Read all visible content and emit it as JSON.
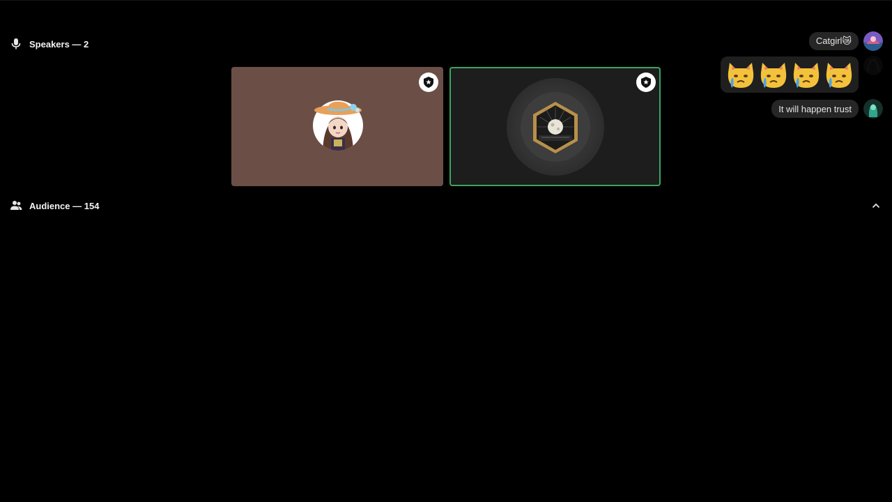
{
  "speakers": {
    "label": "Speakers — 2",
    "icon": "microphone-icon"
  },
  "audience": {
    "label": "Audience — 154",
    "icon": "people-icon",
    "collapse_icon": "chevron-up-icon"
  },
  "tiles": [
    {
      "name": "speaker-tile-1",
      "background": "#6b4f47",
      "speaking": false,
      "badge": "moderator-badge"
    },
    {
      "name": "speaker-tile-2",
      "background": "#1d1d1d",
      "speaking": true,
      "speaking_color": "#3ba55d",
      "badge": "moderator-badge"
    }
  ],
  "chat": {
    "messages": [
      {
        "author_avatar": "avatar-catgirl",
        "text": "Catgirl😿"
      },
      {
        "author_avatar": "avatar-ghost",
        "emoji": [
          "😿",
          "😿",
          "😿",
          "😿"
        ]
      },
      {
        "author_avatar": "avatar-trust",
        "text": "It will happen trust"
      }
    ]
  }
}
